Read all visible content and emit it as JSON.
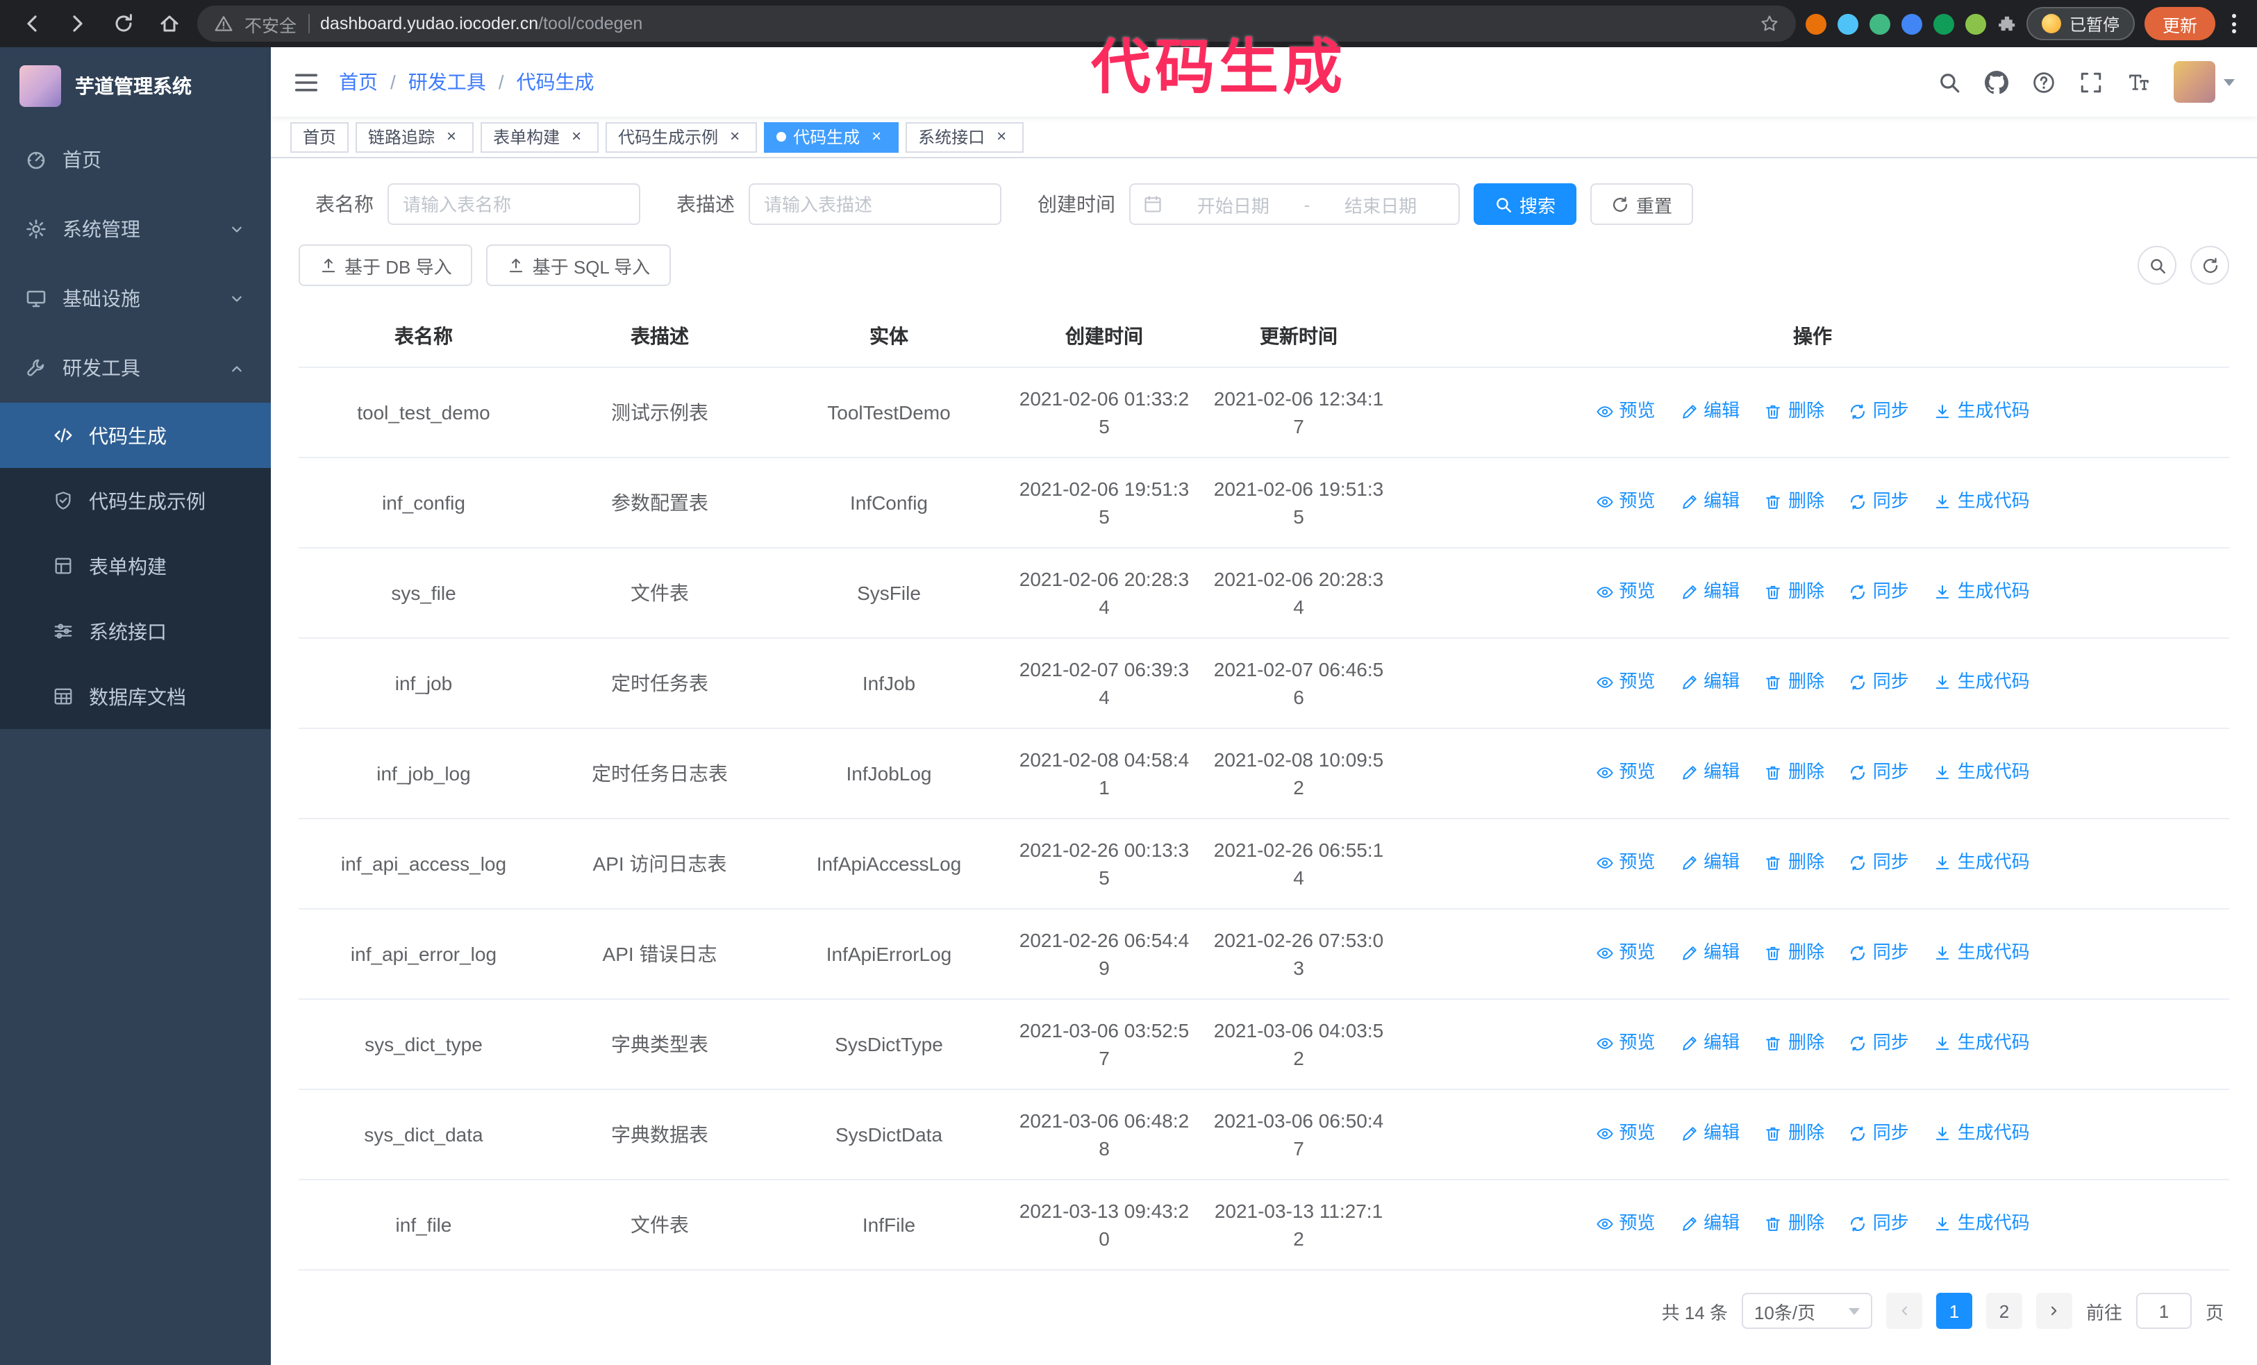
{
  "annotation": {
    "text": "代码生成",
    "color": "#fa2c5e"
  },
  "theme": {
    "accent": "#1890ff",
    "tab_active": "#409eff",
    "sidebar_bg": "#304156",
    "submenu_bg": "#1f2d3d"
  },
  "browser": {
    "security_label": "不安全",
    "url_host": "dashboard.yudao.iocoder.cn",
    "url_path": "/tool/codegen",
    "paused_badge": "已暂停",
    "update_button": "更新"
  },
  "sidebar": {
    "logo_title": "芋道管理系统",
    "items": [
      {
        "label": "首页"
      },
      {
        "label": "系统管理"
      },
      {
        "label": "基础设施"
      },
      {
        "label": "研发工具"
      }
    ],
    "subitems": [
      {
        "label": "代码生成"
      },
      {
        "label": "代码生成示例"
      },
      {
        "label": "表单构建"
      },
      {
        "label": "系统接口"
      },
      {
        "label": "数据库文档"
      }
    ]
  },
  "header": {
    "breadcrumb": [
      "首页",
      "研发工具",
      "代码生成"
    ]
  },
  "tabs": [
    {
      "label": "首页"
    },
    {
      "label": "链路追踪"
    },
    {
      "label": "表单构建"
    },
    {
      "label": "代码生成示例"
    },
    {
      "label": "代码生成"
    },
    {
      "label": "系统接口"
    }
  ],
  "filters": {
    "table_name_label": "表名称",
    "table_name_placeholder": "请输入表名称",
    "table_desc_label": "表描述",
    "table_desc_placeholder": "请输入表描述",
    "create_time_label": "创建时间",
    "date_start_placeholder": "开始日期",
    "date_separator": "-",
    "date_end_placeholder": "结束日期",
    "search_button": "搜索",
    "reset_button": "重置"
  },
  "toolbar": {
    "import_db_button": "基于 DB 导入",
    "import_sql_button": "基于 SQL 导入"
  },
  "table": {
    "columns": [
      "表名称",
      "表描述",
      "实体",
      "创建时间",
      "更新时间",
      "操作"
    ],
    "actions": [
      "预览",
      "编辑",
      "删除",
      "同步",
      "生成代码"
    ],
    "rows": [
      {
        "name": "tool_test_demo",
        "desc": "测试示例表",
        "entity": "ToolTestDemo",
        "created": "2021-02-06 01:33:25",
        "updated": "2021-02-06 12:34:17"
      },
      {
        "name": "inf_config",
        "desc": "参数配置表",
        "entity": "InfConfig",
        "created": "2021-02-06 19:51:35",
        "updated": "2021-02-06 19:51:35"
      },
      {
        "name": "sys_file",
        "desc": "文件表",
        "entity": "SysFile",
        "created": "2021-02-06 20:28:34",
        "updated": "2021-02-06 20:28:34"
      },
      {
        "name": "inf_job",
        "desc": "定时任务表",
        "entity": "InfJob",
        "created": "2021-02-07 06:39:34",
        "updated": "2021-02-07 06:46:56"
      },
      {
        "name": "inf_job_log",
        "desc": "定时任务日志表",
        "entity": "InfJobLog",
        "created": "2021-02-08 04:58:41",
        "updated": "2021-02-08 10:09:52"
      },
      {
        "name": "inf_api_access_log",
        "desc": "API 访问日志表",
        "entity": "InfApiAccessLog",
        "created": "2021-02-26 00:13:35",
        "updated": "2021-02-26 06:55:14"
      },
      {
        "name": "inf_api_error_log",
        "desc": "API 错误日志",
        "entity": "InfApiErrorLog",
        "created": "2021-02-26 06:54:49",
        "updated": "2021-02-26 07:53:03"
      },
      {
        "name": "sys_dict_type",
        "desc": "字典类型表",
        "entity": "SysDictType",
        "created": "2021-03-06 03:52:57",
        "updated": "2021-03-06 04:03:52"
      },
      {
        "name": "sys_dict_data",
        "desc": "字典数据表",
        "entity": "SysDictData",
        "created": "2021-03-06 06:48:28",
        "updated": "2021-03-06 06:50:47"
      },
      {
        "name": "inf_file",
        "desc": "文件表",
        "entity": "InfFile",
        "created": "2021-03-13 09:43:20",
        "updated": "2021-03-13 11:27:12"
      }
    ]
  },
  "pagination": {
    "total": "共 14 条",
    "page_size": "10条/页",
    "pages": [
      "1",
      "2"
    ],
    "active_page": "1",
    "goto_label": "前往",
    "goto_value": "1",
    "goto_suffix": "页"
  }
}
